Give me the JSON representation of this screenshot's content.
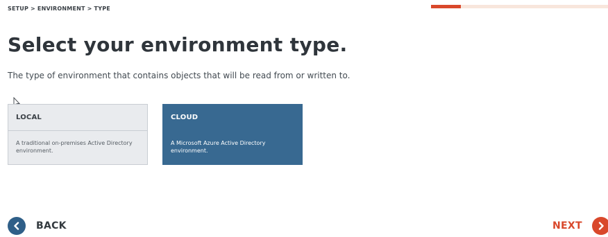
{
  "breadcrumb": "SETUP > ENVIRONMENT > TYPE",
  "progress": {
    "fraction": 0.17,
    "color": "#d9482b"
  },
  "title": "Select your environment type.",
  "description": "The type of environment that contains objects that will be read from or written to.",
  "options": [
    {
      "title": "LOCAL",
      "description": "A traditional on-premises Active Directory environment.",
      "selected": false
    },
    {
      "title": "CLOUD",
      "description": "A Microsoft Azure Active Directory environment.",
      "selected": true
    }
  ],
  "nav": {
    "back_label": "BACK",
    "next_label": "NEXT",
    "back_icon": "chevron-left-icon",
    "next_icon": "chevron-right-icon"
  },
  "colors": {
    "accent": "#d9482b",
    "selected_card": "#386991",
    "back_circle": "#2f5f88"
  }
}
